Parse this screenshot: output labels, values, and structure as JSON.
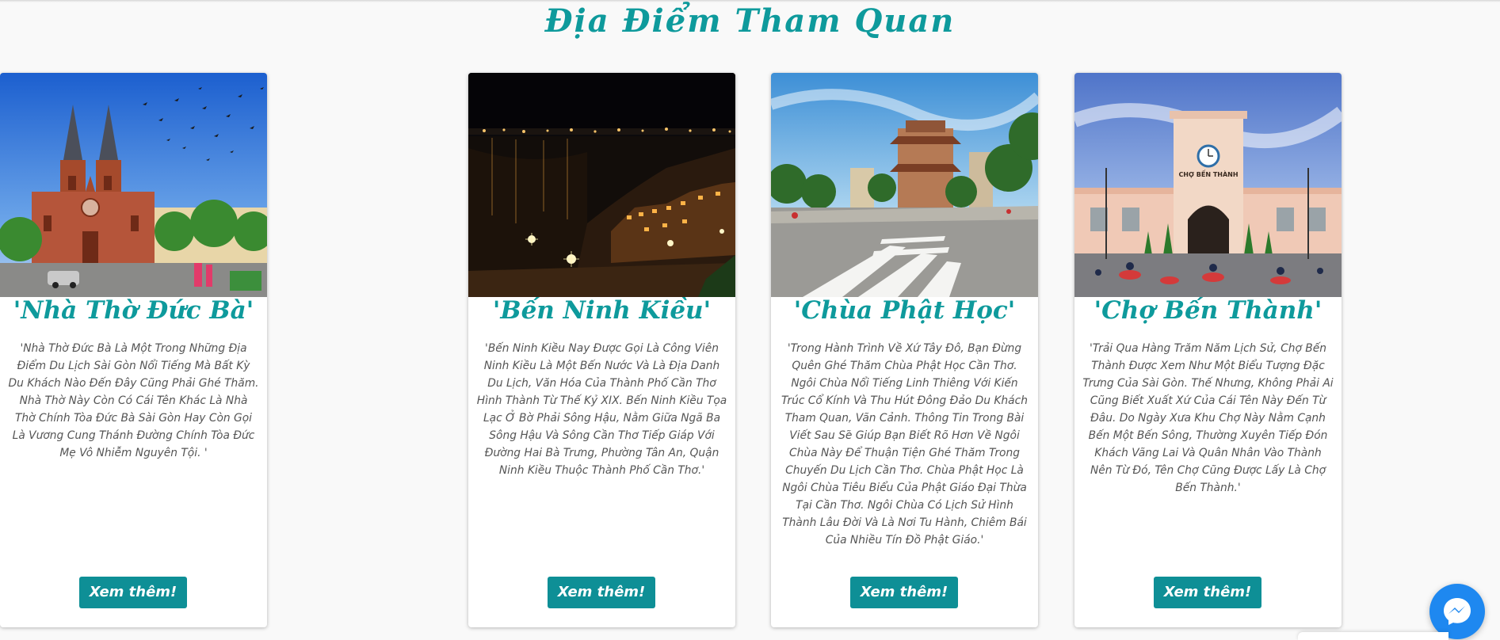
{
  "section": {
    "title": "Địa Điểm Tham Quan"
  },
  "cards": [
    {
      "title": "'Bến Ninh Kiều'",
      "description": "'Bến Ninh Kiều Nay Được Gọi Là Công Viên Ninh Kiều Là Một Bến Nước Và Là Địa Danh Du Lịch, Văn Hóa Của Thành Phố Cần Thơ Hình Thành Từ Thế Kỷ XIX. Bến Ninh Kiều Tọa Lạc Ở Bờ Phải Sông Hậu, Nằm Giữa Ngã Ba Sông Hậu Và Sông Cần Thơ Tiếp Giáp Với Đường Hai Bà Trưng, Phường Tân An, Quận Ninh Kiều Thuộc Thành Phố Cần Thơ.'",
      "button": "Xem thêm!"
    },
    {
      "title": "'Chùa Phật Học'",
      "description": "'Trong Hành Trình Về Xứ Tây Đô, Bạn Đừng Quên Ghé Thăm Chùa Phật Học Cần Thơ. Ngôi Chùa Nổi Tiếng Linh Thiêng Với Kiến Trúc Cổ Kính Và Thu Hút Đông Đảo Du Khách Tham Quan, Vãn Cảnh. Thông Tin Trong Bài Viết Sau Sẽ Giúp Bạn Biết Rõ Hơn Về Ngôi Chùa Này Để Thuận Tiện Ghé Thăm Trong Chuyến Du Lịch Cần Thơ. Chùa Phật Học Là Ngôi Chùa Tiêu Biểu Của Phật Giáo Đại Thừa Tại Cần Thơ. Ngôi Chùa Có Lịch Sử Hình Thành Lâu Đời Và Là Nơi Tu Hành, Chiêm Bái Của Nhiều Tín Đồ Phật Giáo.'",
      "button": "Xem thêm!"
    },
    {
      "title": "'Chợ Bến Thành'",
      "description": "'Trải Qua Hàng Trăm Năm Lịch Sử, Chợ Bến Thành Được Xem Như Một Biểu Tượng Đặc Trưng Của Sài Gòn. Thế Nhưng, Không Phải Ai Cũng Biết Xuất Xứ Của Cái Tên Này Đến Từ Đâu. Do Ngày Xưa Khu Chợ Này Nằm Cạnh Bến Một Bến Sông, Thường Xuyên Tiếp Đón Khách Vãng Lai Và Quân Nhân Vào Thành Nên Từ Đó, Tên Chợ Cũng Được Lấy Là Chợ Bến Thành.'",
      "button": "Xem thêm!",
      "image_sign": "CHỢ BẾN THÀNH"
    },
    {
      "title": "'Nhà Thờ Đức Bà'",
      "description": "'Nhà Thờ Đức Bà Là Một Trong Những Địa Điểm Du Lịch Sài Gòn Nổi Tiếng Mà Bất Kỳ Du Khách Nào Đến Đây Cũng Phải Ghé Thăm. Nhà Thờ Này Còn Có Cái Tên Khác Là Nhà Thờ Chính Tòa Đức Bà Sài Gòn Hay Còn Gọi Là Vương Cung Thánh Đường Chính Tòa Đức Mẹ Vô Nhiễm Nguyên Tội. '",
      "button": "Xem thêm!"
    }
  ],
  "colors": {
    "accent": "#0e9a9c",
    "button": "#0e8f96",
    "text": "#555555",
    "messenger": "#1e88f0"
  },
  "icons": {
    "chat": "messenger-icon"
  }
}
